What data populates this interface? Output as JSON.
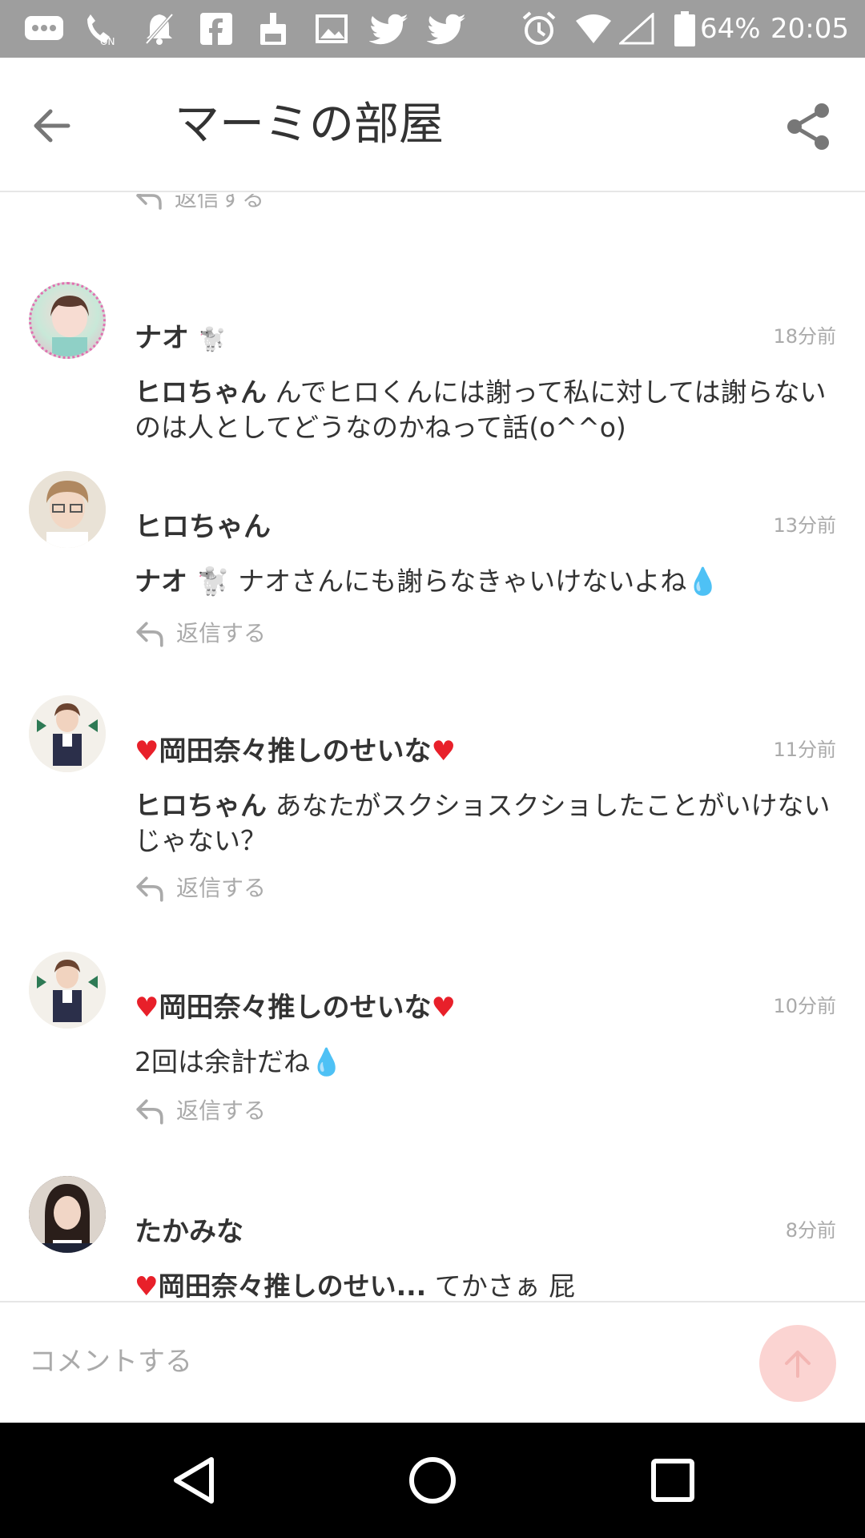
{
  "status_bar": {
    "battery": "64%",
    "time": "20:05",
    "icons": [
      "message-icon",
      "wifi-calling-icon",
      "mute-icon",
      "facebook-icon",
      "cleaner-icon",
      "image-icon",
      "twitter-icon",
      "twitter-icon",
      "alarm-icon",
      "wifi-icon",
      "signal-icon",
      "battery-icon"
    ]
  },
  "header": {
    "title": "マーミの部屋",
    "back_icon": "arrow-left-icon",
    "share_icon": "share-icon"
  },
  "partial_reply_label": "返信する",
  "comments": [
    {
      "author": "ナオ",
      "author_suffix": "🐩",
      "time": "18分前",
      "mention": "ヒロちゃん",
      "text": " んでヒロくんには謝って私に対しては謝らないのは人としてどうなのかねって話(o^^o)",
      "reply_label": ""
    },
    {
      "author": "ヒロちゃん",
      "author_suffix": "",
      "time": "13分前",
      "mention": "ナオ 🐩",
      "text": " ナオさんにも謝らなきゃいけないよね💧",
      "reply_label": "返信する"
    },
    {
      "author": "♥岡田奈々推しのせいな♥",
      "author_suffix": "",
      "time": "11分前",
      "mention": "ヒロちゃん",
      "text": " あなたがスクショスクショしたことがいけないじゃない？",
      "reply_label": "返信する"
    },
    {
      "author": "♥岡田奈々推しのせいな♥",
      "author_suffix": "",
      "time": "10分前",
      "mention": "",
      "text": "2回は余計だね💧",
      "reply_label": "返信する"
    },
    {
      "author": "たかみな",
      "author_suffix": "",
      "time": "8分前",
      "mention": "♥岡田奈々推しのせい...",
      "text": " てかさぁ 屁理屈こいてないで謝罪すれば？",
      "reply_label": ""
    }
  ],
  "input": {
    "placeholder": "コメントする",
    "send_icon": "arrow-up-icon",
    "send_color": "#fbd4d2"
  },
  "nav_bar": {
    "back_icon": "triangle-back-icon",
    "home_icon": "circle-home-icon",
    "recents_icon": "square-recents-icon"
  },
  "colors": {
    "status_bar": "#9e9e9e",
    "heart": "#e8202a",
    "secondary_text": "#aaaaaa"
  }
}
